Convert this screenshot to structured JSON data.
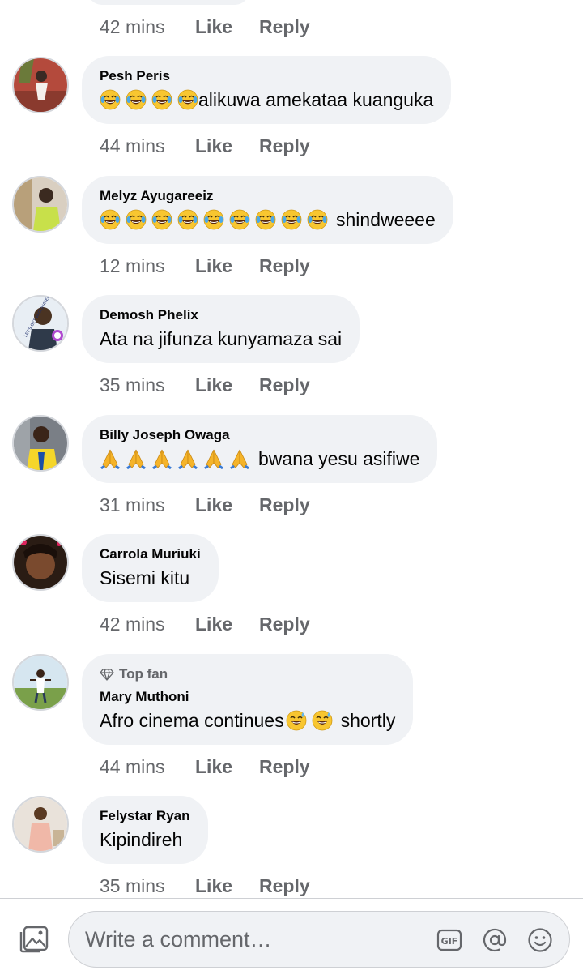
{
  "comments_top": {
    "time": "42 mins",
    "like": "Like",
    "reply": "Reply"
  },
  "comments": [
    {
      "author": "Pesh Peris",
      "emoji": "joy",
      "emoji_count": 4,
      "text": "alikuwa amekataa kuanguka",
      "time": "44 mins",
      "like": "Like",
      "reply": "Reply"
    },
    {
      "author": "Melyz Ayugareeiz",
      "emoji": "joy",
      "emoji_count": 9,
      "text": "shindweeee",
      "time": "12 mins",
      "like": "Like",
      "reply": "Reply"
    },
    {
      "author": "Demosh Phelix",
      "text": "Ata na jifunza kunyamaza sai",
      "time": "35 mins",
      "like": "Like",
      "reply": "Reply"
    },
    {
      "author": "Billy Joseph Owaga",
      "emoji": "pray",
      "emoji_count": 6,
      "text": "bwana yesu asifiwe",
      "time": "31 mins",
      "like": "Like",
      "reply": "Reply"
    },
    {
      "author": "Carrola Muriuki",
      "text": "Sisemi kitu",
      "time": "42 mins",
      "like": "Like",
      "reply": "Reply"
    },
    {
      "author": "Mary Muthoni",
      "badge": "Top fan",
      "text_before": "Afro cinema continues",
      "emoji": "sweat-smile",
      "emoji_count": 2,
      "text_after": "shortly",
      "time": "44 mins",
      "like": "Like",
      "reply": "Reply"
    },
    {
      "author": "Felystar Ryan",
      "text": "Kipindireh",
      "time": "35 mins",
      "like": "Like",
      "reply": "Reply"
    }
  ],
  "composer": {
    "placeholder": "Write a comment…",
    "icons": [
      "photo-icon",
      "gif-icon",
      "mention-icon",
      "emoji-icon"
    ]
  },
  "colors": {
    "bubble": "#f0f2f5",
    "meta": "#65676b",
    "text": "#050505"
  }
}
